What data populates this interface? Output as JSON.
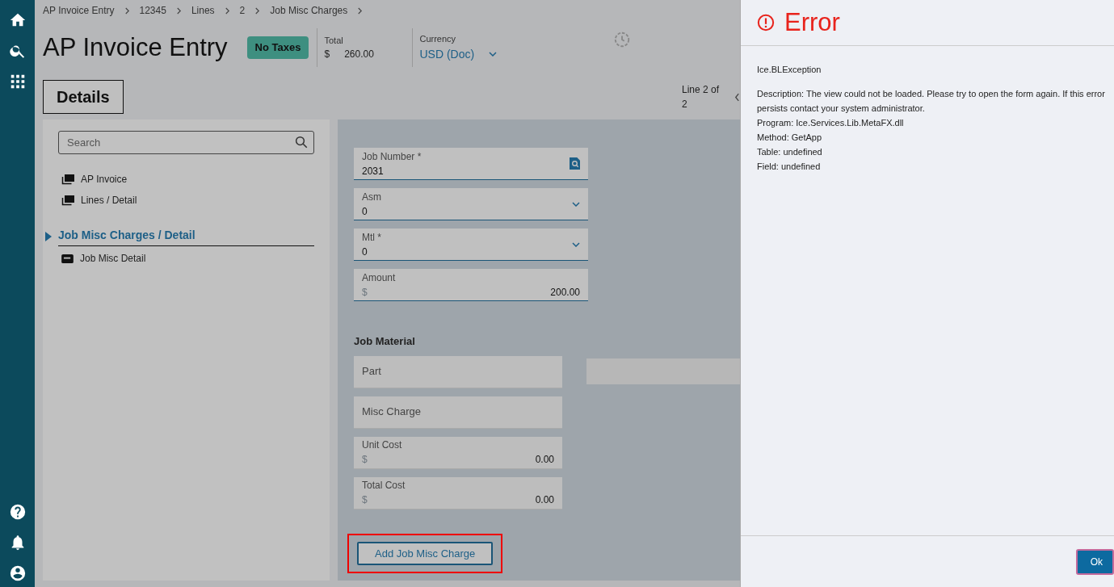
{
  "breadcrumbs": [
    "AP Invoice Entry",
    "12345",
    "Lines",
    "2",
    "Job Misc Charges"
  ],
  "header": {
    "title": "AP Invoice Entry",
    "badge": "No Taxes",
    "total": {
      "label": "Total",
      "currency": "$",
      "value": "260.00"
    },
    "currency": {
      "label": "Currency",
      "value": "USD (Doc)"
    }
  },
  "tabs": [
    {
      "label": "Details",
      "selected": true
    }
  ],
  "record_position": "Line 2 of 2",
  "sidebar": {
    "search": {
      "placeholder": "Search"
    },
    "items": [
      {
        "label": "AP Invoice",
        "kind": "stack",
        "selected": false
      },
      {
        "label": "Lines / Detail",
        "kind": "stack",
        "selected": false
      },
      {
        "label": "Job Misc Charges / Detail",
        "kind": "section",
        "selected": true,
        "expanded": true,
        "children": [
          {
            "label": "Job Misc Detail",
            "kind": "card",
            "selected": false
          }
        ]
      }
    ]
  },
  "form": {
    "fields": [
      {
        "label": "Job Number *",
        "value": "2031",
        "kind": "lookup"
      },
      {
        "label": "Asm",
        "value": "0",
        "kind": "dropdown"
      },
      {
        "label": "Mtl *",
        "value": "0",
        "kind": "dropdown"
      },
      {
        "label": "Amount",
        "prefix": "$",
        "value": "200.00",
        "kind": "currency"
      }
    ],
    "section_title": "Job Material",
    "material_fields": [
      {
        "label": "Part",
        "kind": "empty"
      },
      {
        "label": "Misc Charge",
        "kind": "empty"
      },
      {
        "label": "Unit Cost",
        "prefix": "$",
        "value": "0.00",
        "kind": "currency"
      },
      {
        "label": "Total Cost",
        "prefix": "$",
        "value": "0.00",
        "kind": "currency"
      }
    ],
    "button": {
      "label": "Add Job Misc Charge",
      "highlighted": true
    }
  },
  "error_panel": {
    "title": "Error",
    "exception": "Ice.BLException",
    "details": [
      "Description: The view could not be loaded. Please try to open the form again. If this error persists contact your system administrator.",
      "Program: Ice.Services.Lib.MetaFX.dll",
      "Method: GetApp",
      "Table: undefined",
      "Field: undefined"
    ],
    "button": "Ok"
  }
}
